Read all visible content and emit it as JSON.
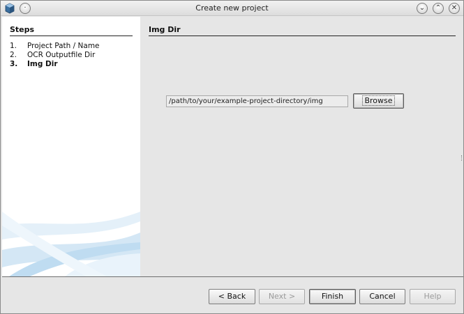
{
  "window": {
    "title": "Create new project"
  },
  "icons": {
    "app": "app-cube-icon",
    "menu": "window-menu-icon",
    "minimize": "minimize-icon",
    "maximize": "maximize-icon",
    "close": "close-icon"
  },
  "steps": {
    "heading": "Steps",
    "items": [
      {
        "number": "1.",
        "label": "Project Path / Name",
        "current": false
      },
      {
        "number": "2.",
        "label": "OCR Outputfile Dir",
        "current": false
      },
      {
        "number": "3.",
        "label": "Img Dir",
        "current": true
      }
    ]
  },
  "content": {
    "heading": "Img Dir",
    "path_value": "/path/to/your/example-project-directory/img",
    "browse_label": "Browse"
  },
  "footer": {
    "back_label": "< Back",
    "next_label": "Next >",
    "finish_label": "Finish",
    "cancel_label": "Cancel",
    "help_label": "Help"
  },
  "colors": {
    "swoosh": "#cfe4f4"
  }
}
